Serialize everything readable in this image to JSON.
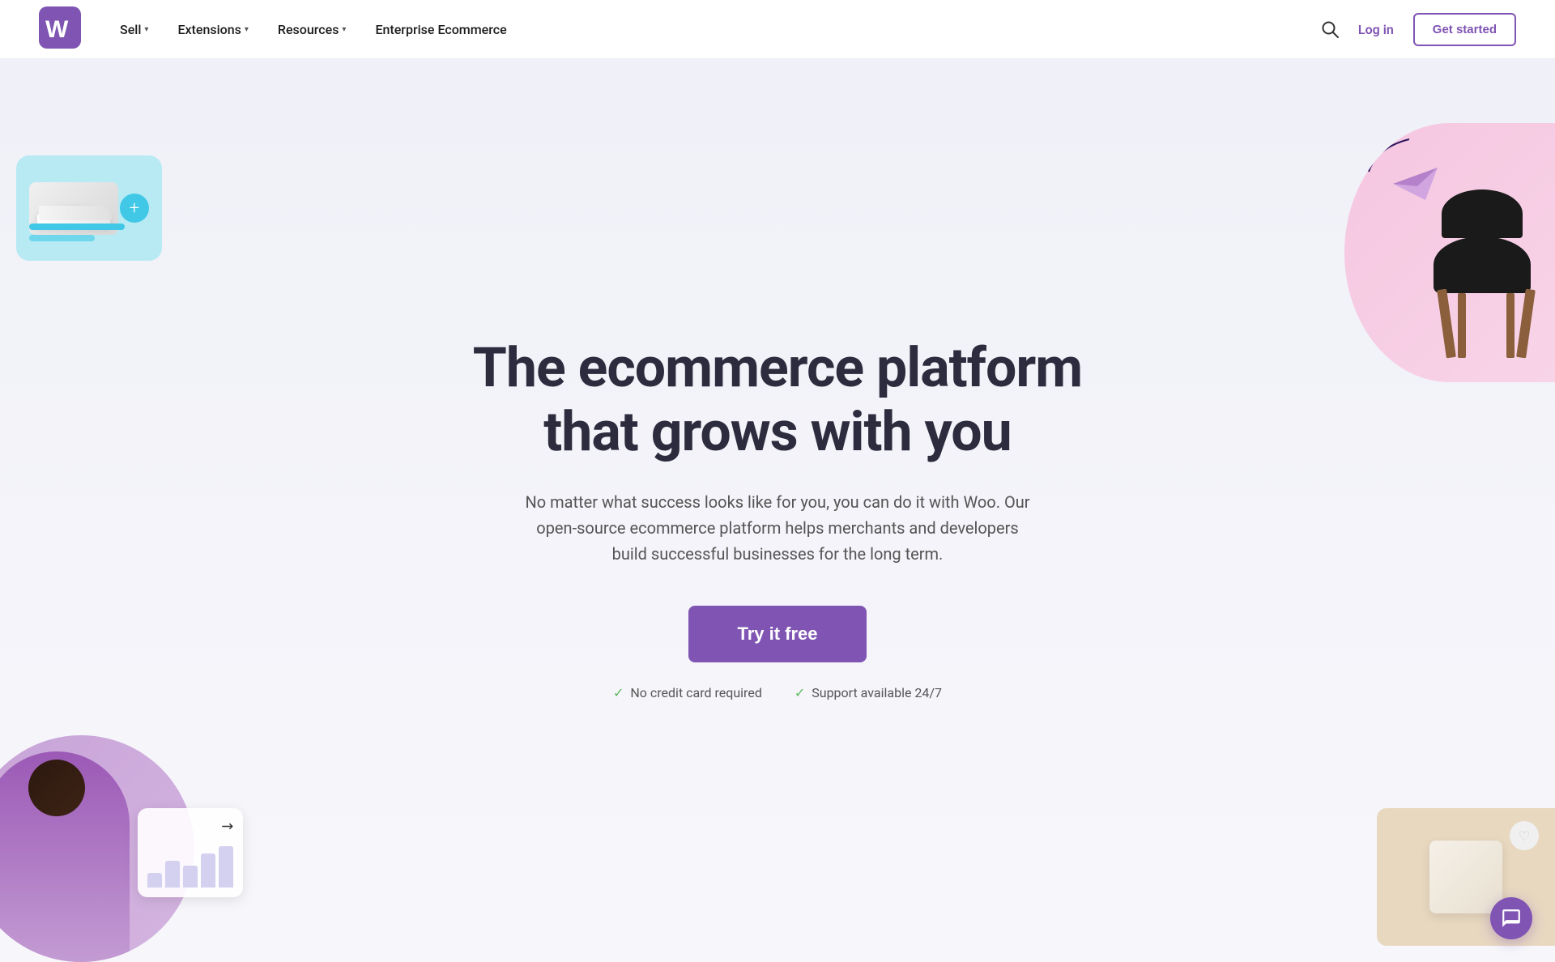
{
  "nav": {
    "logo_alt": "WooCommerce",
    "links": [
      {
        "label": "Sell",
        "has_dropdown": true
      },
      {
        "label": "Extensions",
        "has_dropdown": true
      },
      {
        "label": "Resources",
        "has_dropdown": true
      },
      {
        "label": "Enterprise Ecommerce",
        "has_dropdown": false
      }
    ],
    "login_label": "Log in",
    "get_started_label": "Get started"
  },
  "hero": {
    "title": "The ecommerce platform that grows with you",
    "subtitle": "No matter what success looks like for you, you can do it with Woo. Our open-source ecommerce platform helps merchants and developers build successful businesses for the long term.",
    "cta_label": "Try it free",
    "trust_badges": [
      {
        "label": "No credit card required"
      },
      {
        "label": "Support available 24/7"
      }
    ]
  },
  "chat": {
    "aria_label": "Open chat"
  },
  "colors": {
    "brand_purple": "#7f54b3",
    "accent_teal": "#40c8e6",
    "accent_pink": "#f5c6e0",
    "text_dark": "#2c2c3e"
  }
}
